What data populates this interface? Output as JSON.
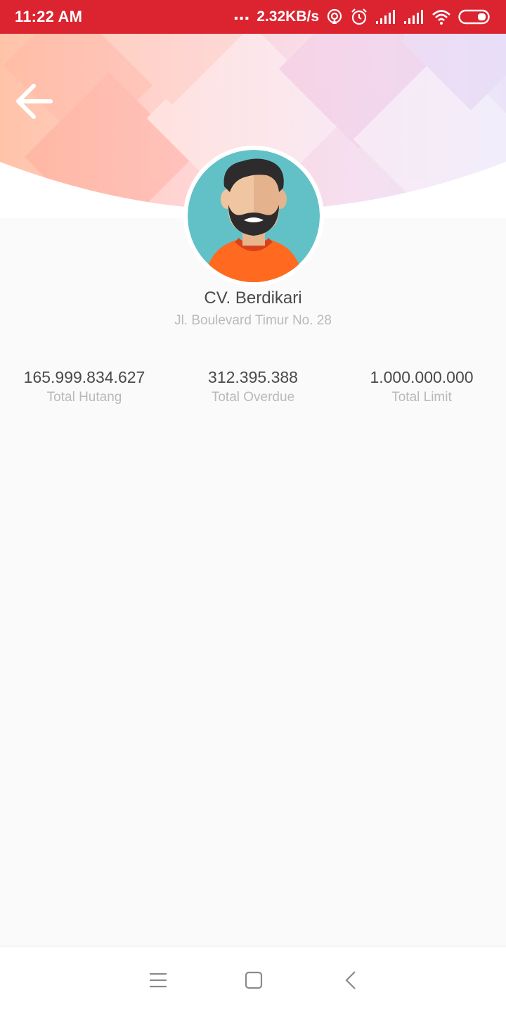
{
  "status_bar": {
    "time": "11:22 AM",
    "dots": "...",
    "net_speed": "2.32KB/s",
    "icons": [
      "hotspot-icon",
      "alarm-icon",
      "signal-icon",
      "signal-icon",
      "wifi-icon",
      "battery-icon"
    ]
  },
  "header": {
    "back_icon": "arrow-left-icon",
    "avatar_icon": "bearded-man-avatar-icon"
  },
  "profile": {
    "name": "CV. Berdikari",
    "address": "Jl. Boulevard Timur No. 28"
  },
  "stats": [
    {
      "value": "165.999.834.627",
      "label": "Total Hutang"
    },
    {
      "value": "312.395.388",
      "label": "Total Overdue"
    },
    {
      "value": "1.000.000.000",
      "label": "Total Limit"
    }
  ],
  "nav_bar": {
    "icons": [
      "menu-icon",
      "home-square-icon",
      "back-chevron-icon"
    ]
  },
  "colors": {
    "status_bar": "#db2430",
    "text_primary": "#4a4a4a",
    "text_secondary": "#b9b9b9",
    "avatar_bg": "#62c1c7",
    "shirt": "#ff6a20"
  }
}
